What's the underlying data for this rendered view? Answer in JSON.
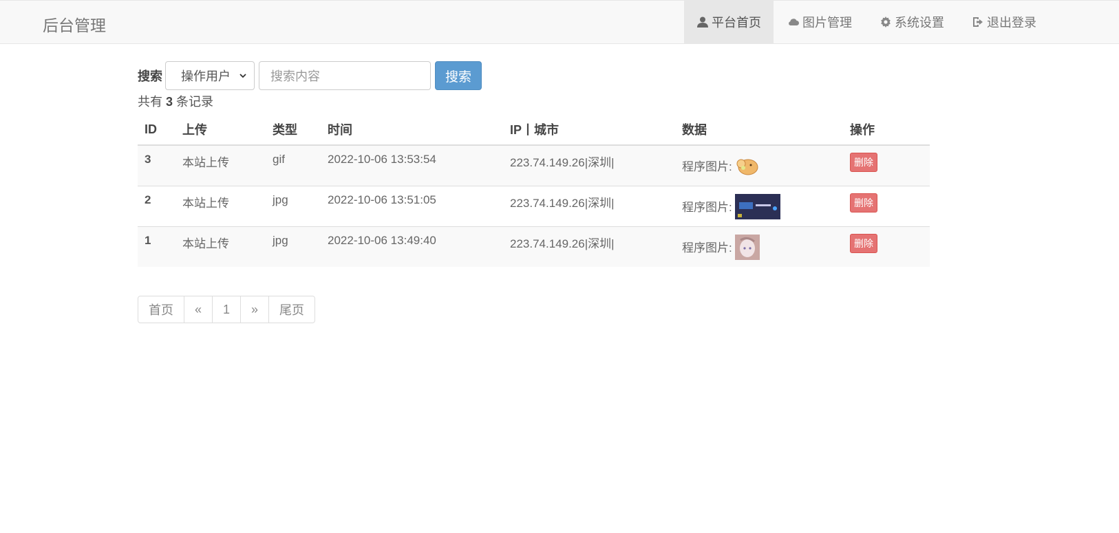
{
  "navbar": {
    "brand": "后台管理",
    "items": [
      {
        "label": "平台首页",
        "icon": "user-icon",
        "active": true
      },
      {
        "label": "图片管理",
        "icon": "cloud-icon",
        "active": false
      },
      {
        "label": "系统设置",
        "icon": "gear-icon",
        "active": false
      },
      {
        "label": "退出登录",
        "icon": "logout-icon",
        "active": false
      }
    ]
  },
  "search": {
    "label": "搜索",
    "select_value": "操作用户",
    "placeholder": "搜索内容",
    "button": "搜索"
  },
  "summary": {
    "prefix": "共有",
    "count": "3",
    "suffix": "条记录"
  },
  "table": {
    "headers": [
      "ID",
      "上传",
      "类型",
      "时间",
      "IP丨城市",
      "数据",
      "操作"
    ],
    "rows": [
      {
        "id": "3",
        "upload": "本站上传",
        "type": "gif",
        "time": "2022-10-06 13:53:54",
        "ip": "223.74.149.26|深圳|",
        "data_label": "程序图片:",
        "action": "删除"
      },
      {
        "id": "2",
        "upload": "本站上传",
        "type": "jpg",
        "time": "2022-10-06 13:51:05",
        "ip": "223.74.149.26|深圳|",
        "data_label": "程序图片:",
        "action": "删除"
      },
      {
        "id": "1",
        "upload": "本站上传",
        "type": "jpg",
        "time": "2022-10-06 13:49:40",
        "ip": "223.74.149.26|深圳|",
        "data_label": "程序图片:",
        "action": "删除"
      }
    ]
  },
  "pagination": [
    "首页",
    "«",
    "1",
    "»",
    "尾页"
  ],
  "colors": {
    "primary": "#5b9bd1",
    "danger": "#e57373",
    "navbar_bg": "#f8f8f8"
  }
}
